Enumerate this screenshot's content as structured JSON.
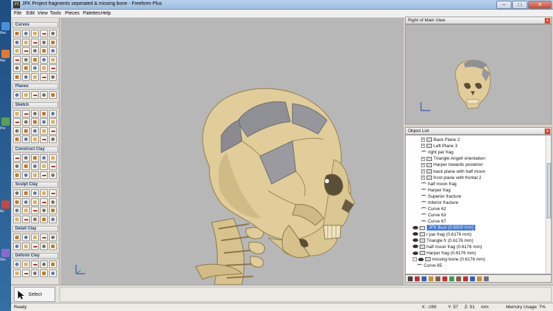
{
  "window": {
    "icon_text": "Ff",
    "title": "JFK Project fragments seperated & missing bone - Freeform Plus",
    "min_glyph": "–",
    "max_glyph": "□",
    "close_glyph": "✕"
  },
  "desktop": {
    "labels": [
      "Rec",
      "Nor",
      "Pre",
      "Ac",
      "Sec"
    ]
  },
  "menu": [
    "File",
    "Edit",
    "View",
    "Tools",
    "Pieces",
    "Palettes",
    "Help"
  ],
  "toolbar": {
    "sections": [
      {
        "label": "Curves",
        "rows": 6
      },
      {
        "label": "Planes",
        "rows": 1
      },
      {
        "label": "Sketch",
        "rows": 4
      },
      {
        "label": "Construct Clay",
        "rows": 3
      },
      {
        "label": "Sculpt Clay",
        "rows": 4
      },
      {
        "label": "Detail Clay",
        "rows": 2
      },
      {
        "label": "Deform Clay",
        "rows": 2
      }
    ]
  },
  "side": {
    "rmv_title": "Right of Main View",
    "objlist_title": "Object List",
    "close_glyph": "x"
  },
  "object_list": [
    {
      "label": "Back Plane 2",
      "indent": 3,
      "type": "plane",
      "expander": "+"
    },
    {
      "label": "Left Plane 3",
      "indent": 3,
      "type": "plane",
      "expander": "+"
    },
    {
      "label": "right par frag",
      "indent": 3,
      "type": "curve",
      "expander": ""
    },
    {
      "label": "Triangle Angell orientation",
      "indent": 3,
      "type": "plane",
      "expander": "+"
    },
    {
      "label": "Harper towards posterior",
      "indent": 3,
      "type": "plane",
      "expander": "+"
    },
    {
      "label": "back plane with half moon",
      "indent": 3,
      "type": "plane",
      "expander": "+"
    },
    {
      "label": "front plane with frontal 2",
      "indent": 3,
      "type": "plane",
      "expander": "+"
    },
    {
      "label": "half moon frag",
      "indent": 3,
      "type": "curve",
      "expander": ""
    },
    {
      "label": "Harper frag",
      "indent": 3,
      "type": "curve",
      "expander": ""
    },
    {
      "label": "Superior fracture",
      "indent": 3,
      "type": "curve",
      "expander": ""
    },
    {
      "label": "Inferior fracture",
      "indent": 3,
      "type": "curve",
      "expander": ""
    },
    {
      "label": "Curve 62",
      "indent": 3,
      "type": "curve",
      "expander": ""
    },
    {
      "label": "Curve 63",
      "indent": 3,
      "type": "curve",
      "expander": ""
    },
    {
      "label": "Curve 67",
      "indent": 3,
      "type": "curve",
      "expander": ""
    },
    {
      "label": "JFK Bust (0.6500 mm)",
      "indent": 1,
      "type": "clay",
      "expander": "",
      "selected": true
    },
    {
      "label": "r par frag (0.6176 mm)",
      "indent": 1,
      "type": "clay",
      "expander": ""
    },
    {
      "label": "Triangle fr (0.6176 mm)",
      "indent": 1,
      "type": "clay",
      "expander": ""
    },
    {
      "label": "half moon frag (0.6176 mm)",
      "indent": 1,
      "type": "clay",
      "expander": ""
    },
    {
      "label": "Harper frag (0.6176 mm)",
      "indent": 1,
      "type": "clay",
      "expander": ""
    },
    {
      "label": "missing bone (0.6176 mm)",
      "indent": 1,
      "type": "clay",
      "expander": "−"
    },
    {
      "label": "Curve 65",
      "indent": 2,
      "type": "curve",
      "expander": ""
    }
  ],
  "tools": {
    "select_label": "Select"
  },
  "status": {
    "ready": "Ready",
    "x": "X: -199",
    "y": "Y: 57",
    "z": "Z: 51",
    "units": "mm",
    "memory": "Memory Usage: 7%"
  },
  "colors": {
    "bone": "#e0cd9a",
    "bone_shadow": "#a8925e",
    "fragment": "#8f8f96",
    "viewport_bg": "#b7b7b7",
    "selection": "#3875d7"
  }
}
